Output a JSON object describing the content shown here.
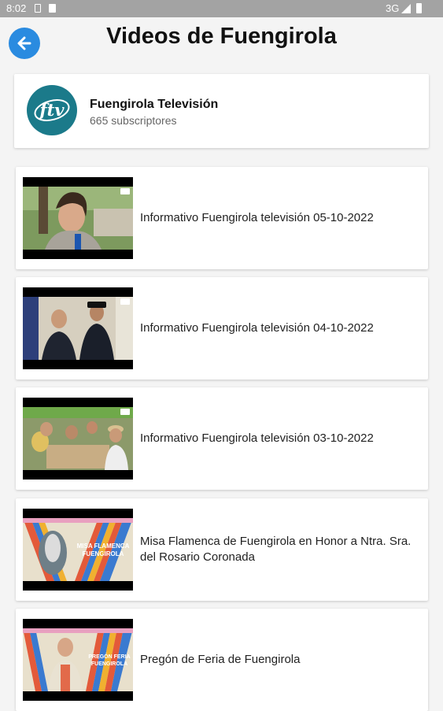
{
  "status_bar": {
    "time": "8:02",
    "network": "3G"
  },
  "header": {
    "title": "Videos de Fuengirola"
  },
  "channel": {
    "name": "Fuengirola Televisión",
    "subscribers": "665 subscriptores",
    "logo_text": "ftv"
  },
  "videos": [
    {
      "title": "Informativo Fuengirola televisión 05-10-2022"
    },
    {
      "title": "Informativo Fuengirola televisión 04-10-2022"
    },
    {
      "title": "Informativo Fuengirola televisión 03-10-2022"
    },
    {
      "title": "Misa Flamenca de Fuengirola en Honor a Ntra. Sra. del Rosario Coronada"
    },
    {
      "title": "Pregón de Feria de Fuengirola"
    }
  ],
  "colors": {
    "accent": "#2a8be0",
    "logo_teal": "#1b7a8a"
  }
}
